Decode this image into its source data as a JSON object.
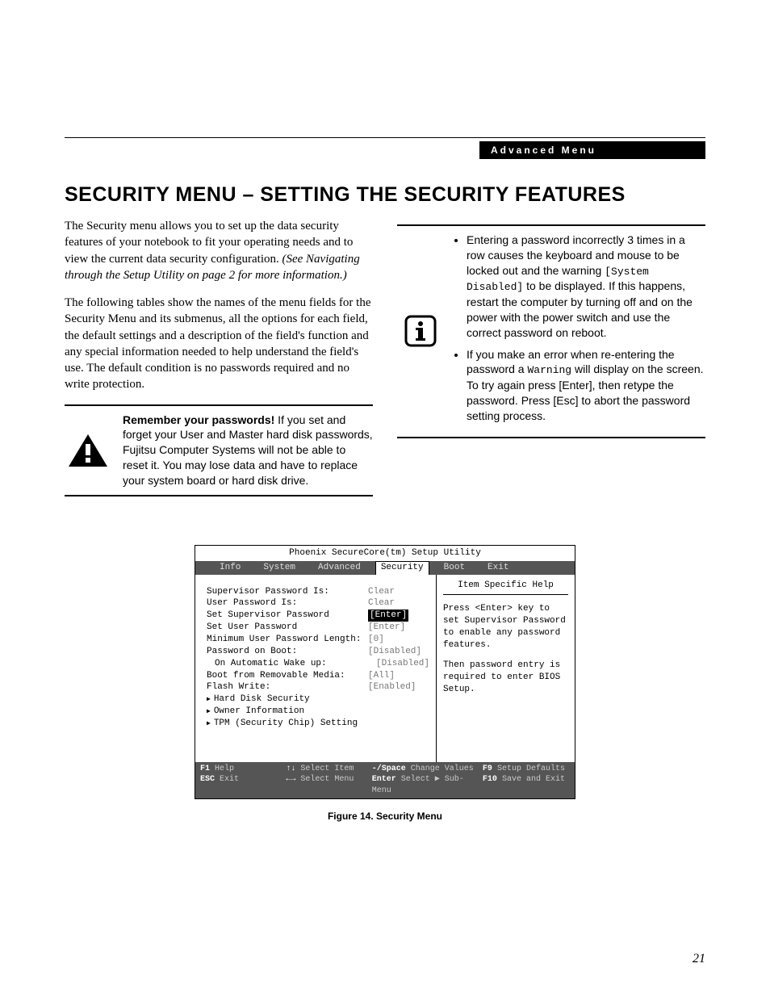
{
  "header_label": "Advanced Menu",
  "page_number": "21",
  "title": "SECURITY MENU – SETTING THE SECURITY FEATURES",
  "intro_p1_a": "The Security menu allows you to set up the data security features of your notebook to fit your operating needs and to view the current data security configuration. ",
  "intro_p1_b": "(See Navigating through the Setup Utility on page 2 for more information.)",
  "intro_p2": "The following tables show the names of the menu fields for the Security Menu and its submenus, all the options for each field, the default settings and a description of the field's function and any special information needed to help understand the field's use. The default condition is no passwords required and no write protection.",
  "warning_bold": "Remember your passwords!",
  "warning_text": " If you set and forget your User and Master hard disk passwords, Fujitsu Computer Systems will not be able to reset it. You may lose data and have to replace your system board or hard disk drive.",
  "info_bullet1_a": "Entering a password incorrectly 3 times in a row causes the keyboard and mouse to be locked out and the warning ",
  "info_bullet1_code": "[System Disabled]",
  "info_bullet1_b": " to be displayed. If this happens, restart the computer by turning off and on the power with the power switch and use the correct password on reboot.",
  "info_bullet2_a": "If you make an error when re-entering the password a ",
  "info_bullet2_code": "Warning",
  "info_bullet2_b": " will display on the screen. To try again press [Enter], then retype the password. Press [Esc] to abort the password setting process.",
  "bios": {
    "utility_title": "Phoenix SecureCore(tm) Setup Utility",
    "tabs": [
      "Info",
      "System",
      "Advanced",
      "Security",
      "Boot",
      "Exit"
    ],
    "active_tab": "Security",
    "rows": [
      {
        "label": "Supervisor Password Is:",
        "value": "Clear",
        "cls": ""
      },
      {
        "label": "User Password Is:",
        "value": "Clear",
        "cls": ""
      },
      {
        "label": "",
        "value": "",
        "cls": ""
      },
      {
        "label": "Set Supervisor Password",
        "value": "[Enter]",
        "cls": "sel"
      },
      {
        "label": "Set User Password",
        "value": "[Enter]",
        "cls": ""
      },
      {
        "label": "Minimum User Password Length:",
        "value": "[0]",
        "cls": ""
      },
      {
        "label": "Password on Boot:",
        "value": "[Disabled]",
        "cls": ""
      },
      {
        "label": "  On Automatic Wake up:",
        "value": "[Disabled]",
        "cls": "",
        "indent": true
      },
      {
        "label": "Boot from Removable Media:",
        "value": "[All]",
        "cls": ""
      },
      {
        "label": "Flash Write:",
        "value": "[Enabled]",
        "cls": ""
      }
    ],
    "submenus": [
      "Hard Disk Security",
      "Owner Information",
      "TPM (Security Chip) Setting"
    ],
    "help_title": "Item Specific Help",
    "help_p1": "Press <Enter> key to set Supervisor Password to enable any password features.",
    "help_p2": "Then password entry is required to enter BIOS Setup.",
    "footer": {
      "r1": [
        {
          "k": "F1",
          "t": "Help"
        },
        {
          "k": "↑↓",
          "t": "Select Item"
        },
        {
          "k": "-/Space",
          "t": "Change Values"
        },
        {
          "k": "F9",
          "t": "Setup Defaults"
        }
      ],
      "r2": [
        {
          "k": "ESC",
          "t": "Exit"
        },
        {
          "k": "←→",
          "t": "Select Menu"
        },
        {
          "k": "Enter",
          "t": "Select ▶ Sub-Menu"
        },
        {
          "k": "F10",
          "t": "Save and Exit"
        }
      ]
    }
  },
  "figure_caption": "Figure 14.  Security Menu"
}
